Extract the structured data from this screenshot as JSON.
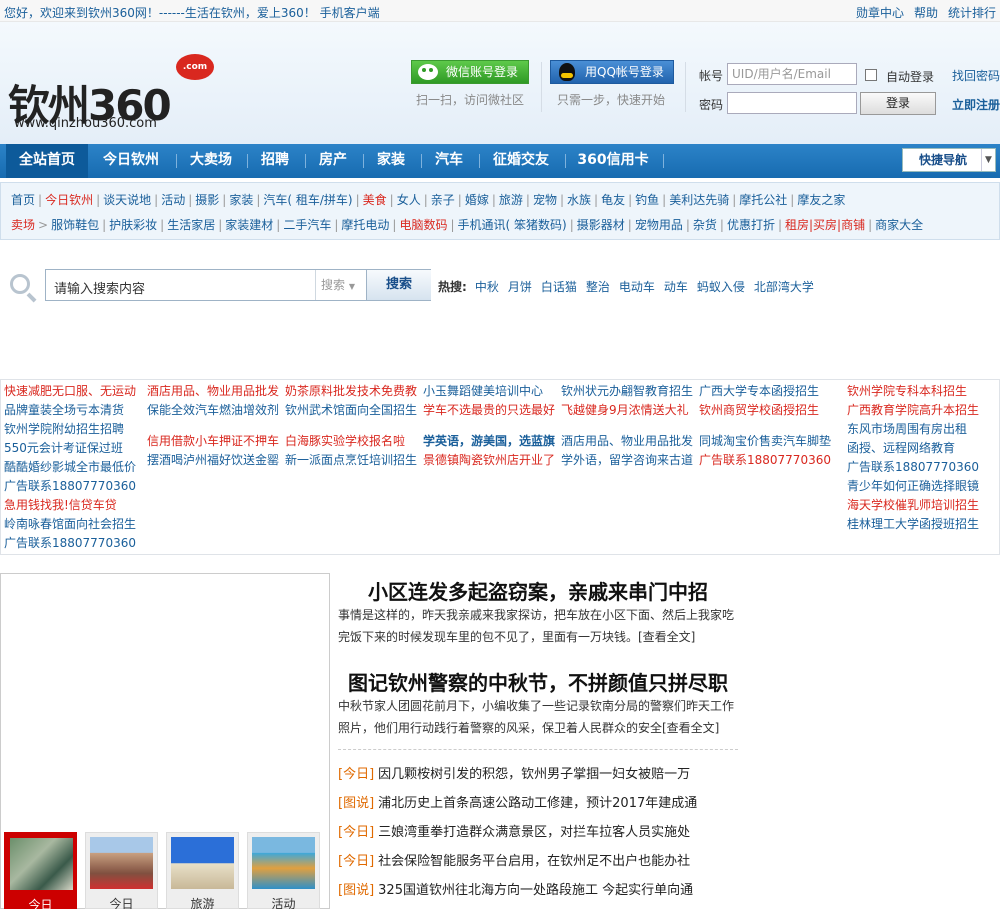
{
  "topbar": {
    "welcome": "您好，欢迎来到钦州360网！------生活在钦州，爱上360！   手机客户端",
    "links": [
      "勋章中心",
      "帮助",
      "统计排行"
    ]
  },
  "logo": {
    "text": "钦州360",
    "badge": ".com",
    "url": "www.qinzhou360.com"
  },
  "social": {
    "wechat_label": "微信账号登录",
    "wechat_tip": "扫一扫，访问微社区",
    "qq_label": "用QQ帐号登录",
    "qq_tip": "只需一步，快速开始"
  },
  "login": {
    "account_label": "帐号",
    "account_placeholder": "UID/用户名/Email",
    "password_label": "密码",
    "auto_login": "自动登录",
    "login_button": "登录",
    "find_password": "找回密码",
    "register": "立即注册"
  },
  "nav": {
    "items": [
      "全站首页",
      "今日钦州",
      "大卖场",
      "招聘",
      "房产",
      "家装",
      "汽车",
      "征婚交友",
      "360信用卡"
    ],
    "quick": "快捷导航"
  },
  "cats": {
    "row1": [
      "首页",
      "今日钦州",
      "谈天说地",
      "活动",
      "摄影",
      "家装",
      "汽车( 租车/拼车)",
      "美食",
      "女人",
      "亲子",
      "婚嫁",
      "旅游",
      "宠物",
      "水族",
      "龟友",
      "钓鱼",
      "美利达先骑",
      "摩托公社",
      "摩友之家"
    ],
    "row2": [
      "卖场",
      "服饰鞋包",
      "护肤彩妆",
      "生活家居",
      "家装建材",
      "二手汽车",
      "摩托电动",
      "电脑数码",
      "手机通讯( 笨猪数码)",
      "摄影器材",
      "宠物用品",
      "杂货",
      "优惠打折",
      "租房|买房|商铺",
      "商家大全"
    ]
  },
  "search": {
    "placeholder": "请输入搜索内容",
    "select": "搜索",
    "button": "搜索",
    "hot_label": "热搜:",
    "hot": [
      "中秋",
      "月饼",
      "白话猫",
      "整治",
      "电动车",
      "动车",
      "蚂蚁入侵",
      "北部湾大学"
    ]
  },
  "ads": {
    "c1": [
      "快速减肥无口服、无运动",
      "品牌童装全场亏本清货",
      "钦州学院附幼招生招聘",
      "550元会计考证保过班",
      "酷酷婚纱影城全市最低价",
      "广告联系18807770360",
      "急用钱找我!信贷车贷",
      "岭南咏春馆面向社会招生",
      "广告联系18807770360"
    ],
    "c2": [
      "酒店用品、物业用品批发",
      "保能全效汽车燃油增效剂",
      "信用借款小车押证不押车",
      "摆酒喝泸州福好饮送金罂"
    ],
    "c3": [
      "奶茶原料批发技术免费教",
      "钦州武术馆面向全国招生",
      "白海豚实验学校报名啦",
      "新一派面点烹饪培训招生"
    ],
    "c4": [
      "小玉舞蹈健美培训中心",
      "学车不选最贵的只选最好",
      "学英语，游美国，选蓝旗",
      "景德镇陶瓷钦州店开业了"
    ],
    "c5": [
      "钦州状元办翩智教育招生",
      "飞越健身9月浓情送大礼",
      "酒店用品、物业用品批发",
      "学外语，留学咨询来古道"
    ],
    "c6": [
      "广西大学专本函授招生",
      "钦州商贸学校函授招生",
      "同城淘宝价售卖汽车脚垫",
      "广告联系18807770360"
    ],
    "c7": [
      "钦州学院专科本科招生",
      "广西教育学院高升本招生",
      "东风市场周围有房出租",
      "函授、远程网络教育",
      "广告联系18807770360",
      "青少年如何正确选择眼镜",
      "海天学校催乳师培训招生",
      "桂林理工大学函授班招生"
    ]
  },
  "news": {
    "h1": "小区连发多起盗窃案，亲戚来串门中招",
    "s1": "事情是这样的，昨天我亲戚来我家探访，把车放在小区下面、然后上我家吃完饭下来的时候发现车里的包不见了，里面有一万块钱。[查看全文]",
    "h2": "图记钦州警察的中秋节，不拼颜值只拼尽职",
    "s2": "中秋节家人团圆花前月下，小编收集了一些记录钦南分局的警察们昨天工作照片，他们用行动践行着警察的风采，保卫着人民群众的安全[查看全文]",
    "list": [
      {
        "tag": "[今日]",
        "text": "因几颗桉树引发的积怨，钦州男子掌掴一妇女被赔一万"
      },
      {
        "tag": "[图说]",
        "text": "浦北历史上首条高速公路动工修建，预计2017年建成通"
      },
      {
        "tag": "[今日]",
        "text": "三娘湾重拳打造群众满意景区，对拦车拉客人员实施处"
      },
      {
        "tag": "[今日]",
        "text": "社会保险智能服务平台启用，在钦州足不出户也能办社"
      },
      {
        "tag": "[图说]",
        "text": "325国道钦州往北海方向一处路段施工 今起实行单向通"
      }
    ]
  },
  "thumbs": [
    "今日",
    "今日",
    "旅游",
    "活动"
  ]
}
